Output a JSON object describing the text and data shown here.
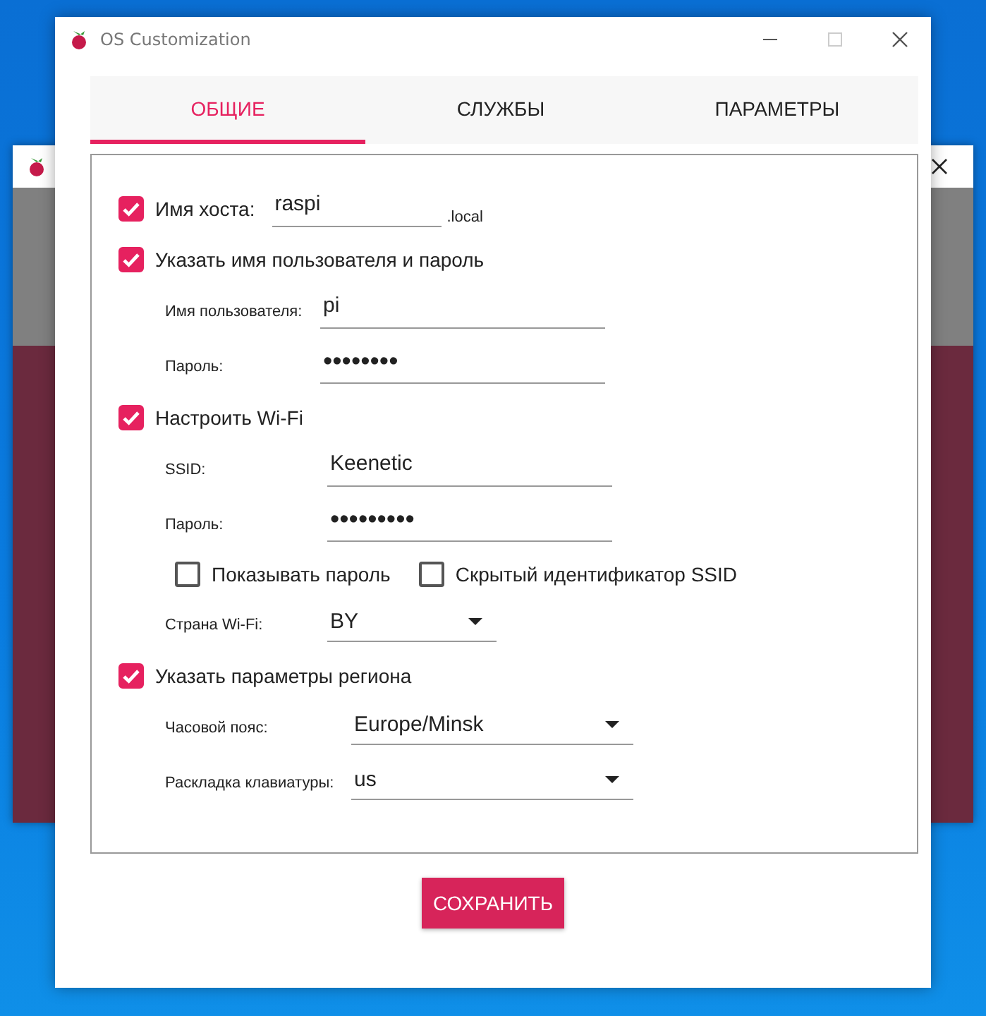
{
  "window": {
    "title": "OS Customization"
  },
  "tabs": [
    {
      "label": "ОБЩИЕ",
      "selected": true
    },
    {
      "label": "СЛУЖБЫ",
      "selected": false
    },
    {
      "label": "ПАРАМЕТРЫ",
      "selected": false
    }
  ],
  "options": [
    {
      "label": "Имя хоста:",
      "checked": true,
      "value": "raspi",
      "suffix": ".local"
    },
    {
      "label": "Указать имя пользователя и пароль",
      "checked": true,
      "children": [
        {
          "kind": "text",
          "label": "Имя пользователя:",
          "value": "pi"
        },
        {
          "kind": "password",
          "label": "Пароль:",
          "value": "••••••••"
        }
      ]
    },
    {
      "label": "Настроить Wi-Fi",
      "checked": true,
      "children": [
        {
          "kind": "text",
          "label": "SSID:",
          "value": "Keenetic"
        },
        {
          "kind": "password",
          "label": "Пароль:",
          "value": "•••••••••"
        },
        {
          "kind": "checks",
          "items": [
            {
              "label": "Показывать пароль",
              "checked": false
            },
            {
              "label": "Скрытый идентификатор SSID",
              "checked": false
            }
          ]
        },
        {
          "kind": "dropdown",
          "label": "Страна Wi-Fi:",
          "value": "BY"
        }
      ]
    },
    {
      "label": "Указать параметры региона",
      "checked": true,
      "children": [
        {
          "kind": "dropdown",
          "label": "Часовой пояс:",
          "value": "Europe/Minsk"
        },
        {
          "kind": "dropdown",
          "label": "Раскладка клавиатуры:",
          "value": "us"
        }
      ]
    }
  ],
  "save_button": "СОХРАНИТЬ"
}
